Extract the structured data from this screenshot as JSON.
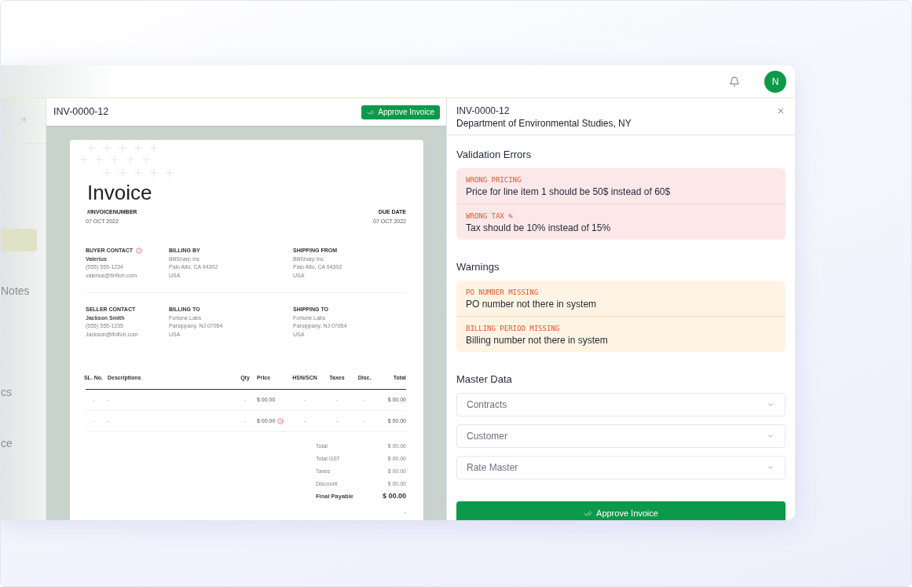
{
  "top_bar": {
    "avatar_initial": "N"
  },
  "sidebar": {
    "groups": [
      [
        {
          "selected": true
        },
        {
          "label": "Notes",
          "selected": false
        }
      ],
      [
        {
          "label": "cs",
          "selected": false
        },
        {
          "label": "ce",
          "selected": false
        }
      ]
    ]
  },
  "invoice_panel": {
    "title": "INV-0000-12",
    "approve_button": "Approve Invoice",
    "document": {
      "heading": "Invoice",
      "number": "#INVOICENUMBER",
      "date": "07 OCT 2022",
      "due_date_label": "DUE DATE",
      "due_date": "07 OCT 2022",
      "party_rows": [
        [
          {
            "heading": "BUYER CONTACT",
            "flagged": true,
            "name": "Valerius",
            "lines": [
              "(555) 555-1234",
              "valerius@finfloh.com"
            ]
          },
          {
            "heading": "BILLING BY",
            "flagged": false,
            "lines": [
              "BillSharp Inc",
              "Palo Alto, CA 94302",
              "USA"
            ]
          },
          {
            "heading": "SHIPPING FROM",
            "flagged": false,
            "lines": [
              "BillSharp Inc",
              "Palo Alto, CA 94302",
              "USA"
            ]
          }
        ],
        [
          {
            "heading": "SELLER CONTACT",
            "flagged": false,
            "name": "Jackson Smith",
            "lines": [
              "(555) 555-1235",
              "Jackson@finfloh.com"
            ]
          },
          {
            "heading": "BILLING TO",
            "flagged": false,
            "lines": [
              "Fortune Labs",
              "Parsippany, NJ 07054",
              "USA"
            ]
          },
          {
            "heading": "SHIPPING TO",
            "flagged": false,
            "lines": [
              "Fortune Labs",
              "Parsippany, NJ 07054",
              "USA"
            ]
          }
        ]
      ],
      "table": {
        "columns": [
          "SL. No.",
          "Descriptions",
          "Qty",
          "Price",
          "HSN/SCN",
          "Taxes",
          "Disc.",
          "Total"
        ],
        "rows": [
          {
            "cells": [
              "-",
              "-",
              "-",
              "$ 00.00",
              "-",
              "-",
              "-",
              "$ 00.00"
            ],
            "price_flagged": false
          },
          {
            "cells": [
              "-",
              "-",
              "-",
              "$ 00.00",
              "-",
              "-",
              "-",
              "$ 00.00"
            ],
            "price_flagged": true
          }
        ]
      },
      "totals": [
        {
          "label": "Total",
          "value": "$ 00.00",
          "kind": "normal"
        },
        {
          "label": "Total GST",
          "value": "$ 00.00",
          "kind": "normal"
        },
        {
          "label": "Taxes",
          "value": "$ 00.00",
          "kind": "normal"
        },
        {
          "label": "Discount",
          "value": "$ 00.00",
          "kind": "normal"
        },
        {
          "label": "Final Payable",
          "value": "$ 00.00",
          "kind": "final"
        }
      ],
      "footer_mark": "-"
    }
  },
  "details_panel": {
    "invoice_number": "INV-0000-12",
    "department": "Department of Environmental Studies, NY",
    "sections": [
      {
        "title": "Validation Errors",
        "kind": "error",
        "items": [
          {
            "code": "WRONG PRICING",
            "message": "Price for line item 1 should be 50$ instead of 60$"
          },
          {
            "code": "WRONG TAX %",
            "message": "Tax should be 10% instead of 15%"
          }
        ]
      },
      {
        "title": "Warnings",
        "kind": "warning",
        "items": [
          {
            "code": "PO NUMBER MISSING",
            "message": "PO number not there in system"
          },
          {
            "code": "BILLING PERIOD MISSING",
            "message": "Billing number not there in system"
          }
        ]
      }
    ],
    "master_data": {
      "title": "Master Data",
      "dropdowns": [
        {
          "label": "Contracts",
          "expanded": false
        },
        {
          "label": "Customer",
          "expanded": false
        },
        {
          "label": "Rate Master",
          "expanded": false
        }
      ]
    },
    "approve_button": "Approve Invoice"
  }
}
